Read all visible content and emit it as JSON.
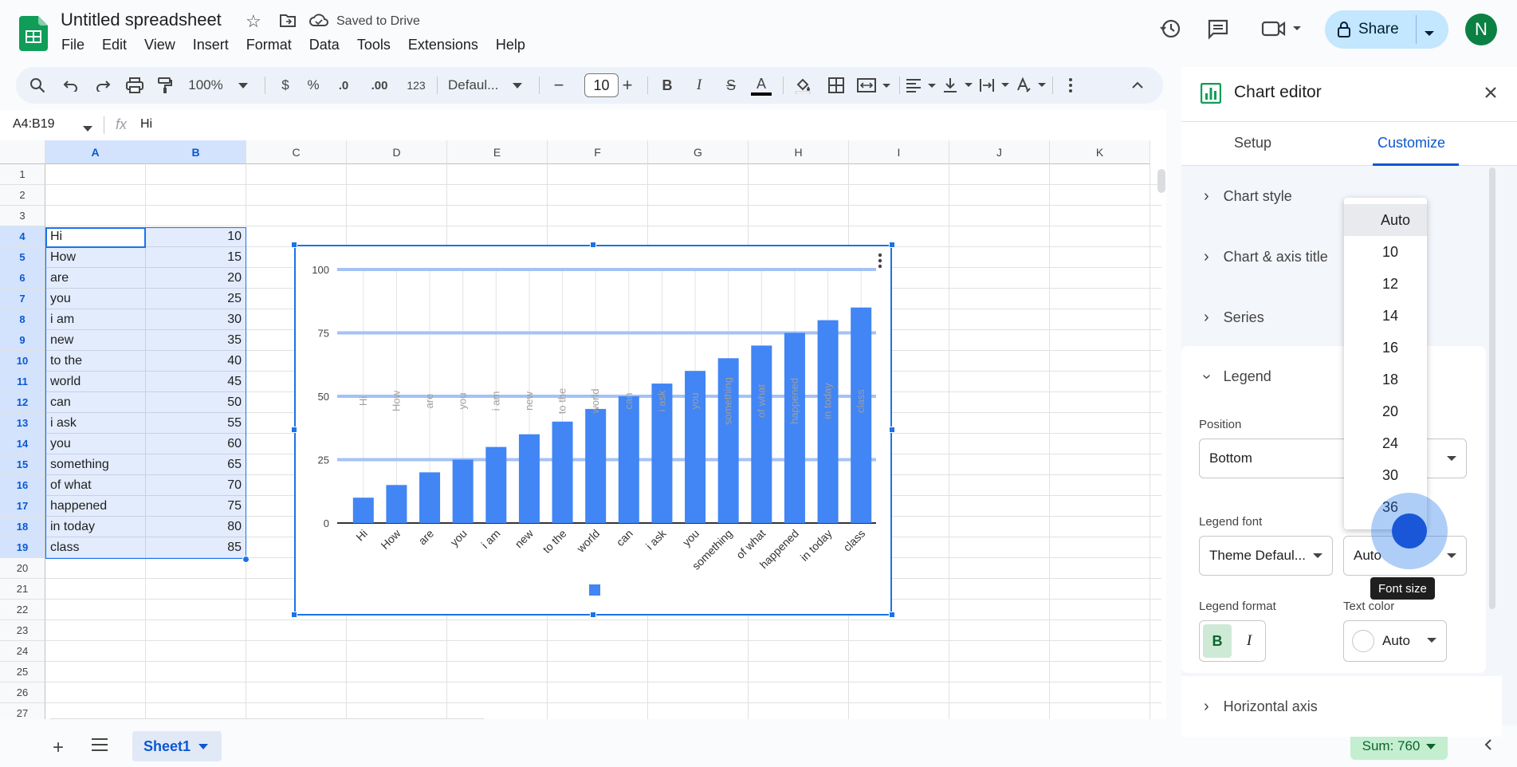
{
  "app": {
    "doc_title": "Untitled spreadsheet",
    "saved_status": "Saved to Drive",
    "menu": [
      "File",
      "Edit",
      "View",
      "Insert",
      "Format",
      "Data",
      "Tools",
      "Extensions",
      "Help"
    ],
    "share_label": "Share",
    "avatar_initial": "N"
  },
  "toolbar": {
    "zoom": "100%",
    "currency": "$",
    "percent": "%",
    "dec_decrease": ".0",
    "dec_increase": ".00",
    "number_format": "123",
    "font": "Defaul...",
    "font_size": "10",
    "bold": "B",
    "italic": "I",
    "strike": "S",
    "text_color": "A"
  },
  "formula_bar": {
    "name_box": "A4:B19",
    "fx": "fx",
    "value": "Hi"
  },
  "grid": {
    "columns": [
      "A",
      "B",
      "C",
      "D",
      "E",
      "F",
      "G",
      "H",
      "I",
      "J",
      "K"
    ],
    "rows": [
      "1",
      "2",
      "3",
      "4",
      "5",
      "6",
      "7",
      "8",
      "9",
      "10",
      "11",
      "12",
      "13",
      "14",
      "15",
      "16",
      "17",
      "18",
      "19",
      "20",
      "21",
      "22",
      "23",
      "24",
      "25",
      "26",
      "27"
    ],
    "data": [
      {
        "a": "Hi",
        "b": "10"
      },
      {
        "a": "How",
        "b": "15"
      },
      {
        "a": "are",
        "b": "20"
      },
      {
        "a": "you",
        "b": "25"
      },
      {
        "a": "i am",
        "b": "30"
      },
      {
        "a": "new",
        "b": "35"
      },
      {
        "a": "to the",
        "b": "40"
      },
      {
        "a": "world",
        "b": "45"
      },
      {
        "a": "can",
        "b": "50"
      },
      {
        "a": "i ask",
        "b": "55"
      },
      {
        "a": "you",
        "b": "60"
      },
      {
        "a": "something",
        "b": "65"
      },
      {
        "a": "of what",
        "b": "70"
      },
      {
        "a": "happened",
        "b": "75"
      },
      {
        "a": "in today",
        "b": "80"
      },
      {
        "a": "class",
        "b": "85"
      }
    ]
  },
  "chart_data": {
    "type": "bar",
    "categories": [
      "Hi",
      "How",
      "are",
      "you",
      "i am",
      "new",
      "to the",
      "world",
      "can",
      "i ask",
      "you",
      "something",
      "of what",
      "happened",
      "in today",
      "class"
    ],
    "values": [
      10,
      15,
      20,
      25,
      30,
      35,
      40,
      45,
      50,
      55,
      60,
      65,
      70,
      75,
      80,
      85
    ],
    "yticks": [
      "0",
      "25",
      "50",
      "75",
      "100"
    ],
    "ylim": [
      0,
      100
    ],
    "bar_color": "#4285f4",
    "grid": true,
    "legend": "bottom"
  },
  "sheet": {
    "tab_name": "Sheet1",
    "sum_label": "Sum: 760"
  },
  "panel": {
    "title": "Chart editor",
    "tab_setup": "Setup",
    "tab_customize": "Customize",
    "sections": [
      "Chart style",
      "Chart & axis title",
      "Series",
      "Legend",
      "Horizontal axis"
    ],
    "position_label": "Position",
    "position_value": "Bottom",
    "legend_font_label": "Legend font",
    "legend_font_value": "Theme Defaul...",
    "font_size_value": "Auto",
    "legend_format_label": "Legend format",
    "text_color_label": "Text color",
    "text_color_value": "Auto",
    "bold": "B",
    "italic": "I"
  },
  "dropdown": {
    "options": [
      "Auto",
      "10",
      "12",
      "14",
      "16",
      "18",
      "20",
      "24",
      "30",
      "36"
    ]
  },
  "tooltip": "Font size"
}
